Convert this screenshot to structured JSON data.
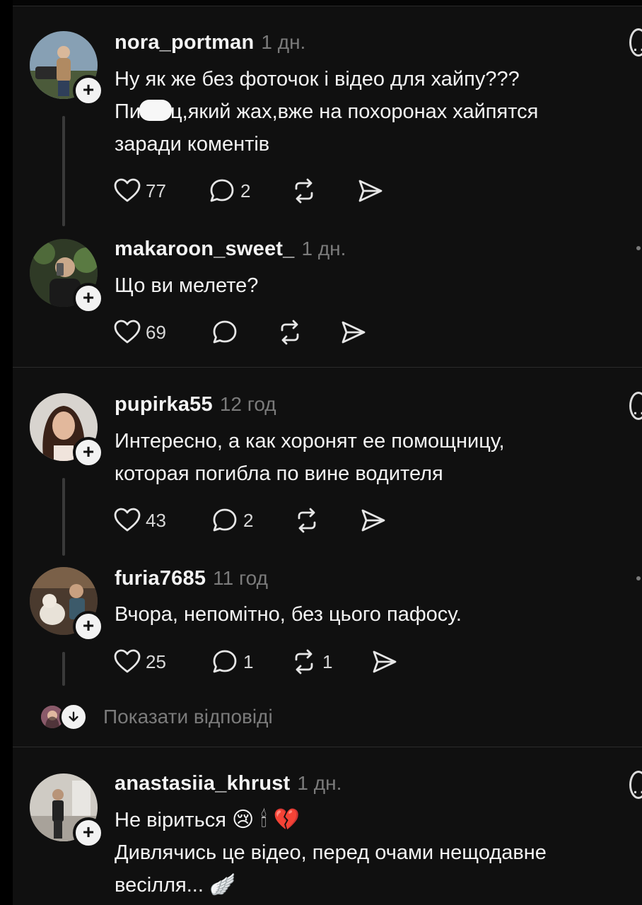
{
  "posts": [
    {
      "username": "nora_portman",
      "time": "1 дн.",
      "lines": [
        "Ну як же без фоточок і відео для хайпу???",
        "Пи",
        "ц,який жах,вже на похоронах хайпятся",
        "заради коментів"
      ],
      "likes": "77",
      "comments": "2",
      "reposts": "",
      "avatar_color": "#5d6a4a"
    },
    {
      "username": "makaroon_sweet_",
      "time": "1 дн.",
      "lines": [
        "Що ви мелете?"
      ],
      "likes": "69",
      "comments": "",
      "reposts": "",
      "avatar_color": "#3b4a32"
    },
    {
      "username": "pupirka55",
      "time": "12 год",
      "lines": [
        "Интересно, а как хоронят ее помощницу,",
        "которая погибла по вине водителя"
      ],
      "likes": "43",
      "comments": "2",
      "reposts": "",
      "avatar_color": "#6a4a3a"
    },
    {
      "username": "furia7685",
      "time": "11 год",
      "lines": [
        "Вчора, непомітно, без цього пафосу."
      ],
      "likes": "25",
      "comments": "1",
      "reposts": "1",
      "avatar_color": "#5a4a3c"
    },
    {
      "username": "anastasiia_khrust",
      "time": "1 дн.",
      "lines": [
        "Не віриться",
        "Дивлячись це відео, перед очами нещодавне",
        "весілля..."
      ],
      "emoji_line1": "😢 🕯 💔",
      "emoji_line3": "🪽",
      "avatar_color": "#8a8680"
    }
  ],
  "show_replies": "Показати відповіді",
  "colors": {
    "background": "#101010",
    "text": "#f3f3f3",
    "muted": "#7b7b7b",
    "divider": "#2c2c2c"
  }
}
